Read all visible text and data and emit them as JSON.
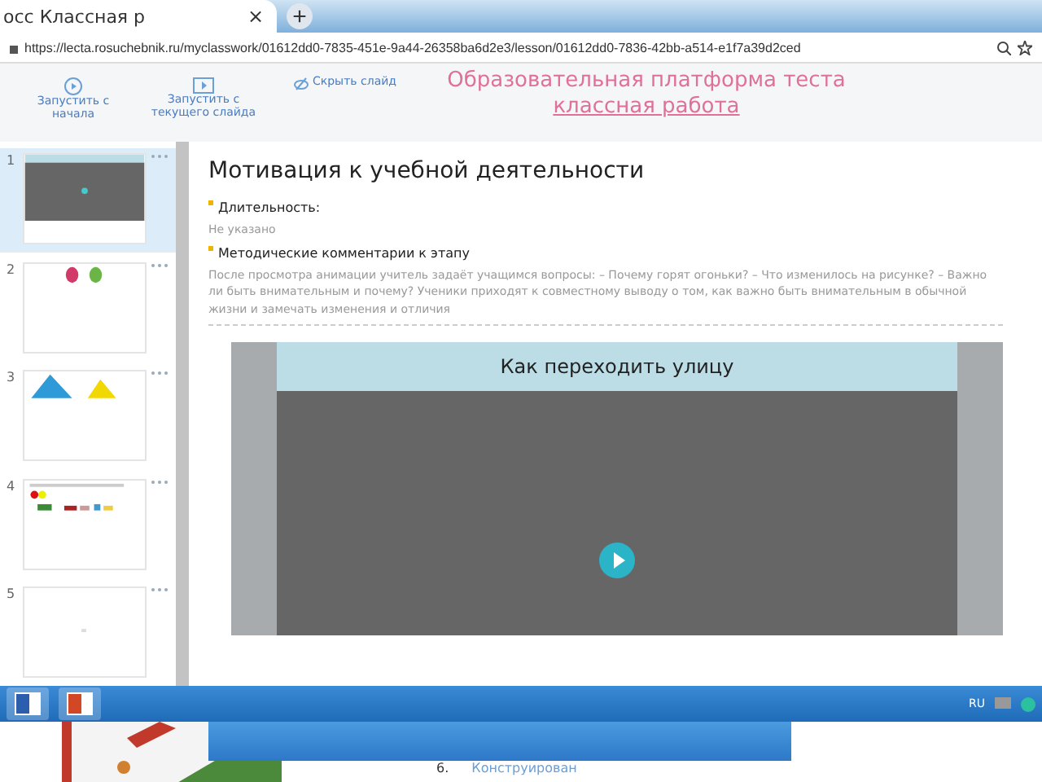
{
  "browser": {
    "tab_title": "осс Классная р",
    "close": "×",
    "new_tab": "+",
    "url": "https://lecta.rosuchebnik.ru/myclasswork/01612dd0-7835-451e-9a44-26358ba6d2e3/lesson/01612dd0-7836-42bb-a514-e1f7a39d2ced"
  },
  "overlay": {
    "lines": [
      "Образовательная платформа теста",
      "классная работа"
    ]
  },
  "toolbar": [
    {
      "label": "Запустить с начала",
      "kind": "play"
    },
    {
      "label": "Запустить с текущего слайда",
      "kind": "current"
    },
    {
      "label": "Скрыть слайд",
      "kind": "hide"
    }
  ],
  "slides": [
    {
      "number": "1",
      "kind": "video",
      "selected": true
    },
    {
      "number": "2",
      "kind": "leaves",
      "selected": false
    },
    {
      "number": "3",
      "kind": "pyramids",
      "selected": false
    },
    {
      "number": "4",
      "kind": "cars",
      "selected": false
    },
    {
      "number": "5",
      "kind": "blank",
      "selected": false
    }
  ],
  "stage": {
    "title": "Мотивация к учебной деятельности",
    "sections": [
      {
        "heading": "Длительность:",
        "body": "Не указано"
      },
      {
        "heading": "Методические комментарии к этапу",
        "body": "После просмотра анимации учитель задаёт учащимся вопросы: – Почему горят огоньки? – Что изменилось на рисунке? – Важно ли быть внимательным и почему? Ученики приходят к совместному выводу о том, как важно быть внимательным в обычной жизни и замечать изменения и отличия"
      }
    ],
    "video_title": "Как переходить улицу"
  },
  "taskbar": {
    "apps": [
      {
        "kind": "word"
      },
      {
        "kind": "powerpoint"
      }
    ],
    "language": "RU"
  },
  "behind": {
    "number": "6.",
    "item": "Конструирован"
  }
}
